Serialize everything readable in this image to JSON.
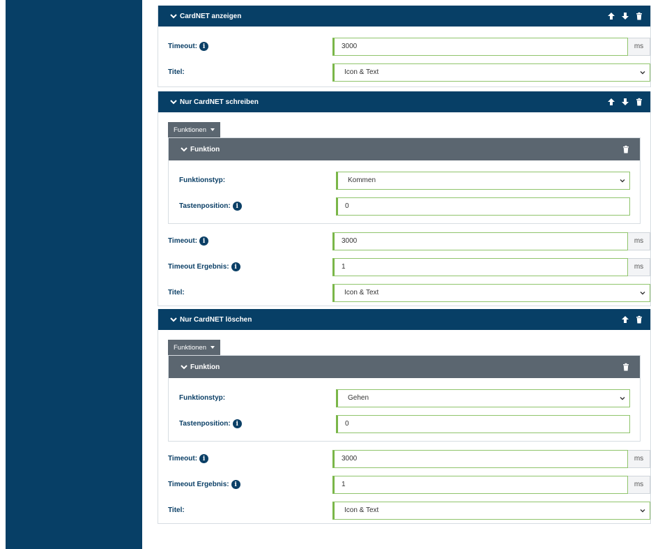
{
  "sections": [
    {
      "title": "CardNET anzeigen",
      "actions": [
        "arrow-up-icon",
        "arrow-down-icon",
        "trash-icon"
      ],
      "rows": [
        {
          "label": "Timeout:",
          "info": true,
          "value": "3000",
          "unit": "ms"
        },
        {
          "label": "Titel:",
          "info": false,
          "select": "Icon & Text"
        }
      ]
    },
    {
      "title": "Nur CardNET schreiben",
      "actions": [
        "arrow-up-icon",
        "arrow-down-icon",
        "trash-icon"
      ],
      "dropdown": "Funktionen",
      "function": {
        "title": "Funktion",
        "type_label": "Funktionstyp:",
        "type_value": "Kommen",
        "pos_label": "Tastenposition:",
        "pos_value": "0"
      },
      "rows": [
        {
          "label": "Timeout:",
          "info": true,
          "value": "3000",
          "unit": "ms"
        },
        {
          "label": "Timeout Ergebnis:",
          "info": true,
          "value": "1",
          "unit": "ms"
        },
        {
          "label": "Titel:",
          "info": false,
          "select": "Icon & Text"
        }
      ]
    },
    {
      "title": "Nur CardNET löschen",
      "actions": [
        "arrow-up-icon",
        "trash-icon"
      ],
      "dropdown": "Funktionen",
      "function": {
        "title": "Funktion",
        "type_label": "Funktionstyp:",
        "type_value": "Gehen",
        "pos_label": "Tastenposition:",
        "pos_value": "0"
      },
      "rows": [
        {
          "label": "Timeout:",
          "info": true,
          "value": "3000",
          "unit": "ms"
        },
        {
          "label": "Timeout Ergebnis:",
          "info": true,
          "value": "1",
          "unit": "ms"
        },
        {
          "label": "Titel:",
          "info": false,
          "select": "Icon & Text"
        }
      ]
    }
  ],
  "colors": {
    "primary": "#073f66",
    "secondary": "#5b6670",
    "accent": "#7ab648"
  }
}
